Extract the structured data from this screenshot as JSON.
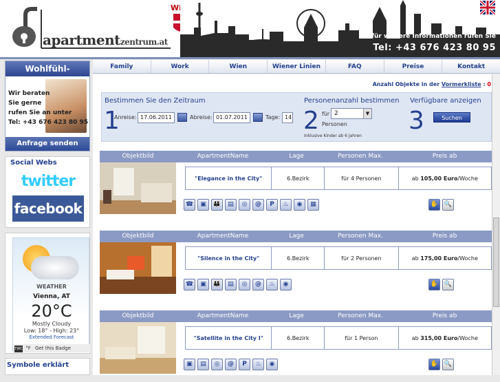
{
  "header": {
    "logo_main": "apartment",
    "logo_sub": "zentrum.at",
    "wien": "Wien",
    "info": "für weitere Informationen rufen Sie",
    "phone": "Tel: +43 676 423 80 95"
  },
  "nav": {
    "items": [
      "Family",
      "Work",
      "Wien",
      "Wiener Linien",
      "FAQ",
      "Preise",
      "Kontakt"
    ]
  },
  "vormerk": {
    "prefix": "Anzahl Objekte in der",
    "link": "Vormerkliste",
    "suffix": ":",
    "count": "0"
  },
  "garantie": {
    "title": "Wohlfühl-Garantie",
    "line1": "Wir beraten",
    "line2": "Sie gerne",
    "line3": "rufen Sie an unter",
    "phone": "Tel: +43 676 423 80 95",
    "button": "Anfrage senden"
  },
  "social": {
    "title": "Social Webs",
    "twitter": "twitter",
    "facebook": "facebook"
  },
  "weather": {
    "brand": "WEATHER",
    "city": "Vienna, AT",
    "temp": "20°C",
    "condition": "Mostly Cloudy",
    "hilo": "Low: 18° - High: 23°",
    "extended": "Extended Forecast",
    "twc": "TWC",
    "unit": "°F",
    "badge": "Get this Badge"
  },
  "symbole": "Symbole erklärt",
  "search": {
    "step1_title": "Bestimmen Sie den Zeitraum",
    "step1_num": "1",
    "anreise_label": "Anreise:",
    "anreise_value": "17.06.2011",
    "abreise_label": "Abreise:",
    "abreise_value": "01.07.2011",
    "tage_label": "Tage:",
    "tage_value": "14",
    "step2_title": "Personenanzahl bestimmen",
    "step2_num": "2",
    "fuer_label": "für",
    "personen_value": "2",
    "personen_label": "Personen",
    "inkl": "Inklusive Kinder ab 6 Jahren",
    "step3_title": "Verfügbare anzeigen",
    "step3_num": "3",
    "suchen": "Suchen"
  },
  "table_headers": [
    "Objektbild",
    "ApartmentName",
    "Lage",
    "Personen Max.",
    "Preis ab"
  ],
  "listings": [
    {
      "name": "\"Elegance in the City\"",
      "lage": "6.Bezirk",
      "personen": "für 4 Personen",
      "preis_prefix": "ab",
      "preis": "105,00 Euro",
      "preis_suffix": "/Woche",
      "icons": [
        "phone-icon",
        "tv-icon",
        "people-icon",
        "fridge-icon",
        "washer-icon",
        "internet-icon",
        "parking-icon",
        "shower-icon",
        "wifi-icon",
        "elevator-icon"
      ],
      "icon_glyphs": [
        "☎",
        "▣",
        "👪",
        "▤",
        "◎",
        "@",
        "P",
        "♨",
        "◉",
        "▦"
      ]
    },
    {
      "name": "\"Silence in the City\"",
      "lage": "6.Bezirk",
      "personen": "für 2 Personen",
      "preis_prefix": "ab",
      "preis": "175,00 Euro",
      "preis_suffix": "/Woche",
      "icons": [
        "phone-icon",
        "tv-icon",
        "people-icon",
        "fridge-icon",
        "washer-icon",
        "internet-icon",
        "shower-icon",
        "wifi-icon"
      ],
      "icon_glyphs": [
        "☎",
        "▣",
        "👪",
        "▤",
        "◎",
        "@",
        "♨",
        "◉"
      ]
    },
    {
      "name": "\"Satellite in the City I\"",
      "lage": "6.Bezirk",
      "personen": "für 1 Person",
      "preis_prefix": "ab",
      "preis": "315,00 Euro",
      "preis_suffix": "/Woche",
      "icons": [
        "tv-icon",
        "fridge-icon",
        "washer-icon",
        "internet-icon",
        "parking-icon",
        "shower-icon",
        "wifi-icon"
      ],
      "icon_glyphs": [
        "▣",
        "▤",
        "◎",
        "@",
        "P",
        "♨",
        "◉"
      ]
    }
  ],
  "actions": {
    "glyph_bookmark": "✋",
    "glyph_zoom": "🔍"
  },
  "colors": {
    "accent": "#25408f",
    "table_head": "#8b9ac4",
    "search_bg": "#dfe6f3"
  }
}
